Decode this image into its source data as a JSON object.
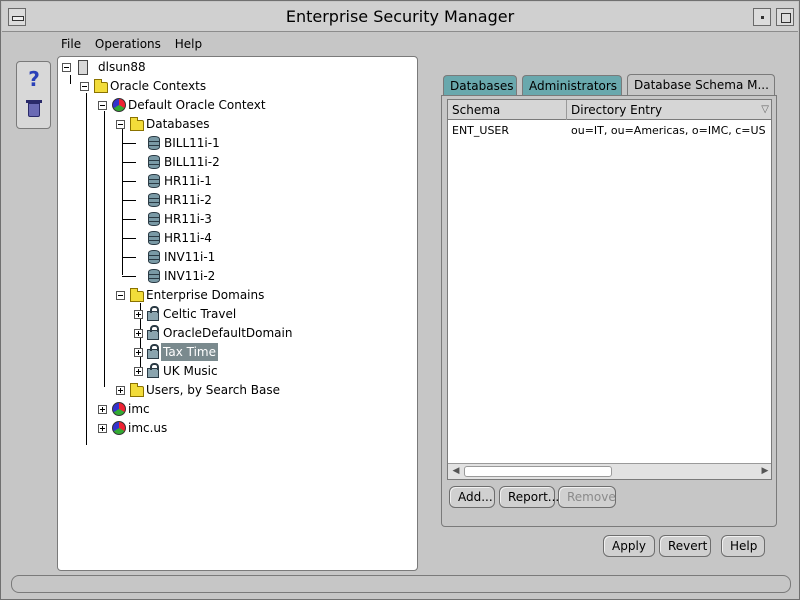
{
  "window": {
    "title": "Enterprise Security Manager"
  },
  "menu": {
    "file": "File",
    "operations": "Operations",
    "help": "Help"
  },
  "toolbar": {
    "help_icon": "question-mark-icon",
    "delete_icon": "trash-icon"
  },
  "tree": {
    "root": "dlsun88",
    "oracle_contexts": "Oracle Contexts",
    "default_context": "Default Oracle Context",
    "databases": "Databases",
    "db_items": [
      "BILL11i-1",
      "BILL11i-2",
      "HR11i-1",
      "HR11i-2",
      "HR11i-3",
      "HR11i-4",
      "INV11i-1",
      "INV11i-2"
    ],
    "enterprise_domains": "Enterprise Domains",
    "domain_items": [
      "Celtic Travel",
      "OracleDefaultDomain",
      "Tax Time",
      "UK Music"
    ],
    "selected_domain": "Tax Time",
    "users_by_search_base": "Users, by Search Base",
    "other_contexts": [
      "imc",
      "imc.us"
    ]
  },
  "tabs": {
    "databases": "Databases",
    "administrators": "Administrators",
    "schema_mappings": "Database Schema M..."
  },
  "schema_table": {
    "headers": {
      "schema": "Schema",
      "directory_entry": "Directory Entry"
    },
    "rows": [
      {
        "schema": "ENT_USER",
        "directory_entry": "ou=IT, ou=Americas, o=IMC, c=US"
      }
    ]
  },
  "table_buttons": {
    "add": "Add...",
    "report": "Report...",
    "remove": "Remove"
  },
  "footer_buttons": {
    "apply": "Apply",
    "revert": "Revert",
    "help": "Help"
  }
}
